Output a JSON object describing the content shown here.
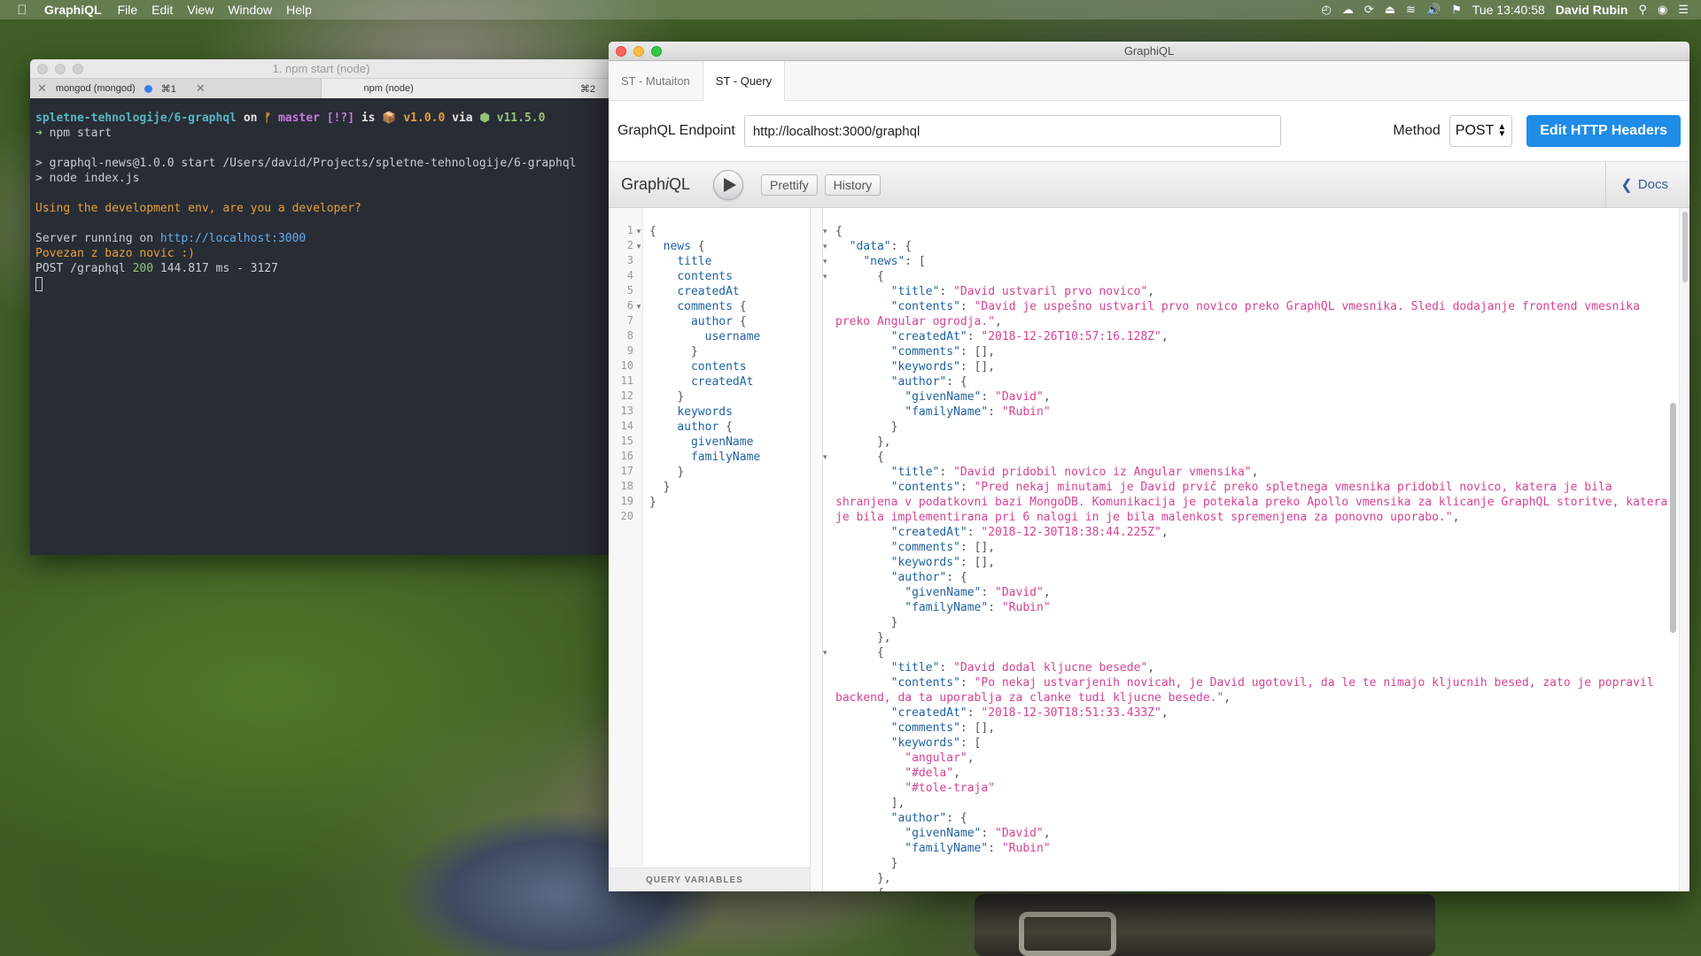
{
  "menubar": {
    "app_name": "GraphiQL",
    "items": [
      "File",
      "Edit",
      "View",
      "Window",
      "Help"
    ],
    "clock": "Tue 13:40:58",
    "user": "David Rubin"
  },
  "terminal": {
    "title": "1. npm start (node)",
    "tabs": [
      {
        "label": "mongod (mongod)",
        "shortcut": "⌘1"
      },
      {
        "label": "npm (node)",
        "shortcut": "⌘2"
      }
    ],
    "prompt_path": "spletne-tehnologije/6-graphql",
    "prompt_on": "on",
    "branch_icon": "ᚠ",
    "branch": "master [!?]",
    "prompt_is": "is",
    "pkg_icon": "📦",
    "version": "v1.0.0",
    "prompt_via": "via",
    "node_icon": "⬢",
    "node_version": "v11.5.0",
    "command_arrow": "➜",
    "command": "npm start",
    "out1": "> graphql-news@1.0.0 start /Users/david/Projects/spletne-tehnologije/6-graphql",
    "out2": "> node index.js",
    "warn": "Using the development env, are you a developer?",
    "server_prefix": "Server running on ",
    "server_url": "http://localhost:3000",
    "db_msg": "Povezan z bazo novic :)",
    "post_prefix": "POST /graphql ",
    "post_status": "200",
    "post_suffix": " 144.817 ms - 3127"
  },
  "graphiql": {
    "window_title": "GraphiQL",
    "tabs": [
      {
        "label": "ST - Mutaiton"
      },
      {
        "label": "ST - Query"
      }
    ],
    "endpoint_label": "GraphQL Endpoint",
    "endpoint_value": "http://localhost:3000/graphql",
    "method_label": "Method",
    "method_value": "POST",
    "edit_headers_label": "Edit HTTP Headers",
    "logo_prefix": "Graph",
    "logo_i": "i",
    "logo_suffix": "QL",
    "prettify_label": "Prettify",
    "history_label": "History",
    "docs_label": "Docs",
    "query_variables_label": "QUERY VARIABLES",
    "query_lines": [
      "{",
      "  news {",
      "    title",
      "    contents",
      "    createdAt",
      "    comments {",
      "      author {",
      "        username",
      "      }",
      "      contents",
      "      createdAt",
      "    }",
      "    keywords",
      "    author {",
      "      givenName",
      "      familyName",
      "    }",
      "  }",
      "}",
      ""
    ],
    "query_fold_lines": [
      1,
      2,
      6
    ],
    "result_news": [
      {
        "title": "David ustvaril prvo novico",
        "contents_line1": "David je uspešno ustvaril prvo novico preko GraphQL vmesnika. Sledi dodajanje frontend vmesnika",
        "contents_line2": "preko Angular ogrodja.",
        "createdAt": "2018-12-26T10:57:16.128Z",
        "keywords": [],
        "givenName": "David",
        "familyName": "Rubin"
      },
      {
        "title": "David pridobil novico iz Angular vmensika",
        "contents_line1": "Pred nekaj minutami je David prvič preko spletnega vmesnika pridobil novico, katera je bila",
        "contents_line2": "shranjena v podatkovni bazi MongoDB. Komunikacija je potekala preko Apollo vmensika za klicanje GraphQL storitve, katera",
        "contents_line3": "je bila implementirana pri 6 nalogi in je bila malenkost spremenjena za ponovno uporabo.",
        "createdAt": "2018-12-30T18:38:44.225Z",
        "keywords": [],
        "givenName": "David",
        "familyName": "Rubin"
      },
      {
        "title": "David dodal kljucne besede",
        "contents_line1": "Po nekaj ustvarjenih novicah, je David ugotovil, da le te nimajo kljucnih besed, zato je popravil",
        "contents_line2": "backend, da ta uporablja za clanke tudi kljucne besede.",
        "createdAt": "2018-12-30T18:51:33.433Z",
        "keywords": [
          "angular",
          "#dela",
          "#tole-traja"
        ],
        "givenName": "David",
        "familyName": "Rubin"
      }
    ]
  }
}
